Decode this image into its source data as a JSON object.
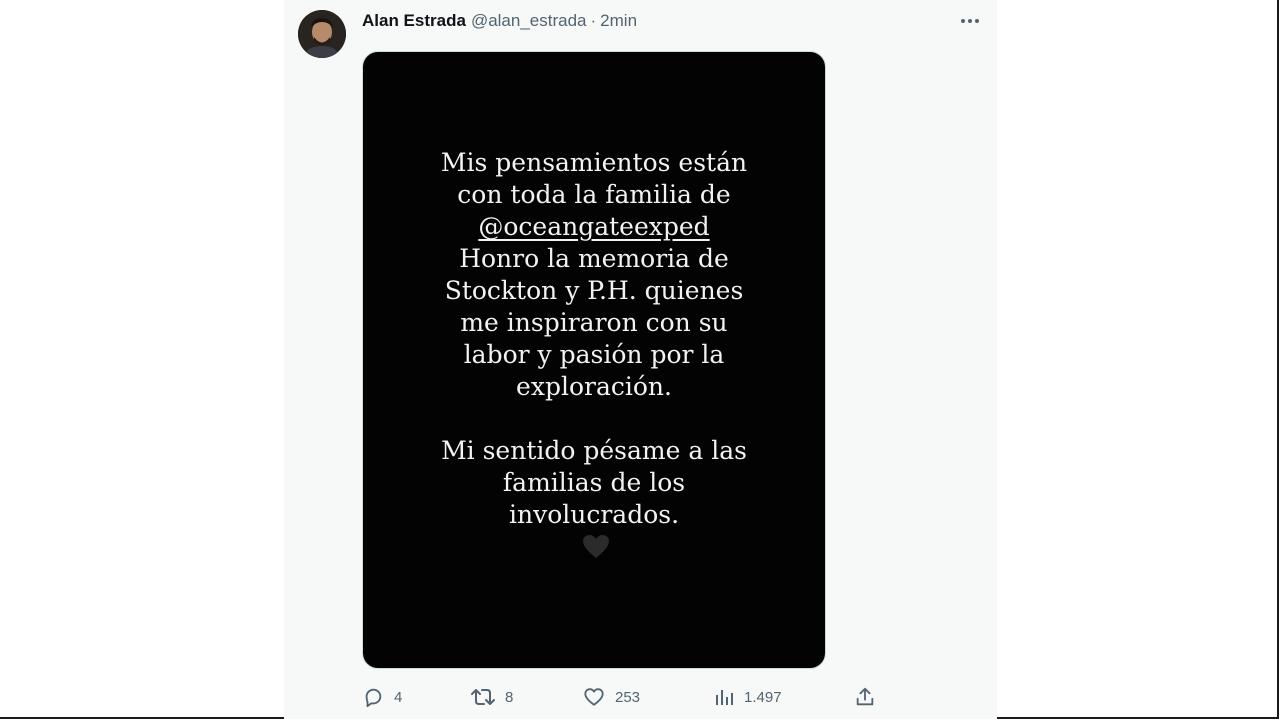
{
  "tweet": {
    "author": {
      "display_name": "Alan Estrada",
      "handle": "@alan_estrada",
      "separator": "·",
      "timestamp": "2min"
    },
    "media": {
      "story_lines": [
        "Mis pensamientos están",
        "con toda la familia de",
        "@oceangateexped",
        "Honro la memoria de",
        "Stockton y P.H. quienes",
        "me inspiraron con su",
        "labor y pasión por la",
        "exploración."
      ],
      "story_lines_2": [
        "Mi sentido pésame a las",
        "familias de los",
        "involucrados."
      ],
      "emoji": "black-heart"
    },
    "actions": {
      "replies": "4",
      "retweets": "8",
      "likes": "253",
      "views": "1.497"
    }
  },
  "icons": {
    "more": "more-horizontal-icon",
    "reply": "reply-icon",
    "retweet": "retweet-icon",
    "like": "heart-icon",
    "views": "views-icon",
    "share": "share-icon"
  },
  "colors": {
    "text_primary": "#0f1419",
    "text_secondary": "#536471",
    "panel_background": "#f7f8f8",
    "media_background": "#030303"
  }
}
